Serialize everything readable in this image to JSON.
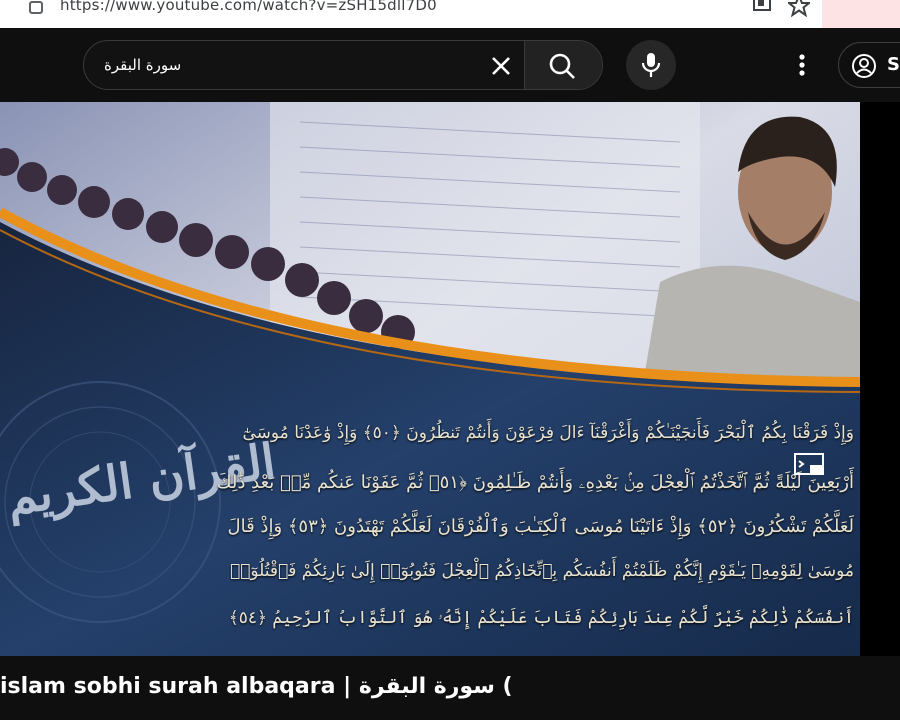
{
  "browser": {
    "url": "https://www.youtube.com/watch?v=zSH15dll7D0",
    "icons": {
      "lock": "lock-icon",
      "extension": "extension-icon",
      "bookmark": "star-icon"
    }
  },
  "header": {
    "search_query": "سورة البقرة",
    "signin_label": "S",
    "icons": {
      "clear": "close-icon",
      "search": "search-icon",
      "mic": "mic-icon",
      "more": "more-vert-icon",
      "account": "account-icon"
    }
  },
  "video": {
    "calligraphy": "القرآن الكريم",
    "verses": [
      "وَإِذْ فَرَقْنَا بِكُمُ ٱلْبَحْرَ فَأَنجَيْنَـٰكُمْ وَأَغْرَقْنَآ ءَالَ فِرْعَوْنَ وَأَنتُمْ تَنظُرُونَ ﴿٥٠﴾ وَإِذْ وَٰعَدْنَا مُوسَىٰٓ",
      "أَرْبَعِينَ لَيْلَةً ثُمَّ ٱتَّخَذْتُمُ ٱلْعِجْلَ مِنۢ بَعْدِهِۦ وَأَنتُمْ ظَـٰلِمُونَ ﴿٥١﴾ ثُمَّ عَفَوْنَا عَنكُم مِّنۢ بَعْدِ ذَٰلِكَ",
      "لَعَلَّكُمْ تَشْكُرُونَ ﴿٥٢﴾ وَإِذْ ءَاتَيْنَا مُوسَى ٱلْكِتَـٰبَ وَٱلْفُرْقَانَ لَعَلَّكُمْ تَهْتَدُونَ ﴿٥٣﴾ وَإِذْ قَالَ",
      "مُوسَىٰ لِقَوْمِهِۦ يَـٰقَوْمِ إِنَّكُمْ ظَلَمْتُمْ أَنفُسَكُم بِٱتِّخَاذِكُمُ ٱلْعِجْلَ فَتُوبُوٓا۟ إِلَىٰ بَارِئِكُمْ فَٱقْتُلُوٓا۟",
      "أَنفُسَكُمْ ذَٰلِكُمْ خَيْرٌ لَّكُمْ عِندَ بَارِئِكُمْ فَتَابَ عَلَيْكُمْ إِنَّهُۥ هُوَ ٱلتَّوَّابُ ٱلرَّحِيمُ ﴿٥٤﴾"
    ],
    "icons": {
      "cast": "cast-icon"
    }
  },
  "title": "islam sobhi surah albaqara | سورة البقرة (",
  "colors": {
    "background": "#0f0f0f",
    "accent_orange": "#e9901a",
    "navy": "#1b2f4f"
  }
}
